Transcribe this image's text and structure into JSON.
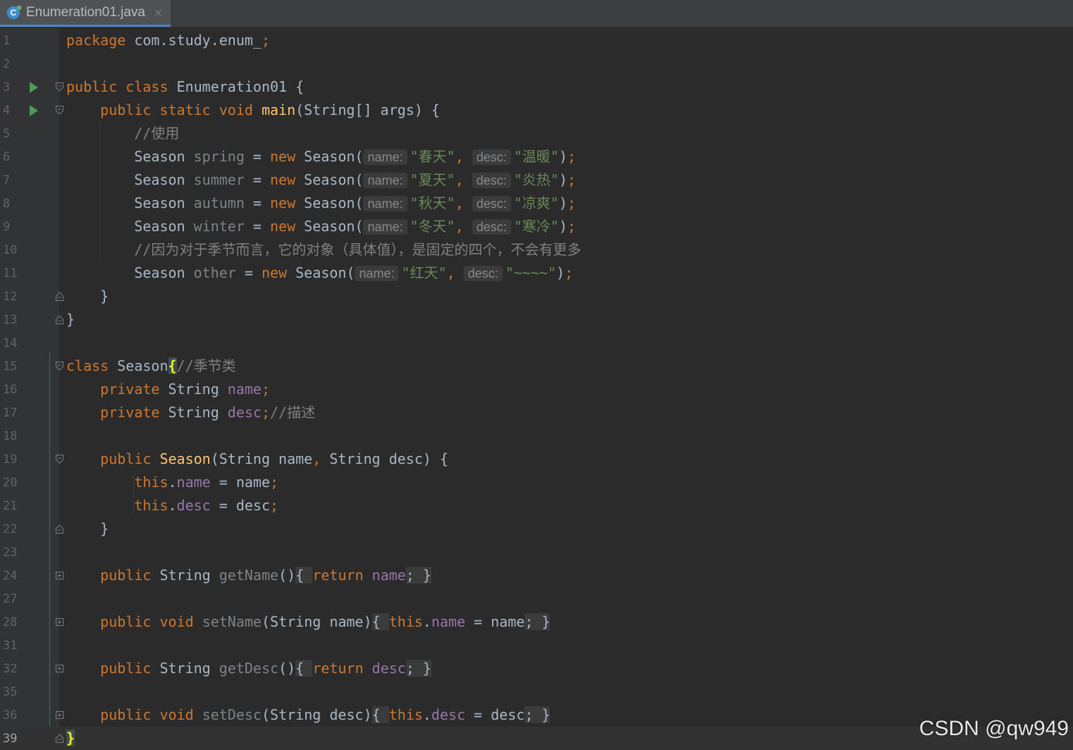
{
  "tab": {
    "title": "Enumeration01.java",
    "icon_letter": "C",
    "close_glyph": "×"
  },
  "editor": {
    "lines": [
      {
        "n": "1"
      },
      {
        "n": "2"
      },
      {
        "n": "3"
      },
      {
        "n": "4"
      },
      {
        "n": "5"
      },
      {
        "n": "6"
      },
      {
        "n": "7"
      },
      {
        "n": "8"
      },
      {
        "n": "9"
      },
      {
        "n": "10"
      },
      {
        "n": "11"
      },
      {
        "n": "12"
      },
      {
        "n": "13"
      },
      {
        "n": "14"
      },
      {
        "n": "15"
      },
      {
        "n": "16"
      },
      {
        "n": "17"
      },
      {
        "n": "18"
      },
      {
        "n": "19"
      },
      {
        "n": "20"
      },
      {
        "n": "21"
      },
      {
        "n": "22"
      },
      {
        "n": "23"
      },
      {
        "n": "24"
      },
      {
        "n": "27"
      },
      {
        "n": "28"
      },
      {
        "n": "31"
      },
      {
        "n": "32"
      },
      {
        "n": "35"
      },
      {
        "n": "36"
      },
      {
        "n": "39"
      }
    ],
    "code": {
      "l1_kw": "package",
      "l1_rest": " com.study.enum_",
      "l1_semi": ";",
      "l3_kw": "public class",
      "l3_rest": " Enumeration01 {",
      "l4_kw": "public static void",
      "l4_fn": "main",
      "l4_rest": "(String[] args) {",
      "l5_cm": "//使用",
      "type_season": "Season",
      "kw_new": "new",
      "ctor_call": "Season(",
      "hint_name": "name:",
      "hint_desc": "desc:",
      "comma": ",",
      "close_paren": ")",
      "semi": ";",
      "eq": " = ",
      "v_spring": "spring",
      "s_spring": "\"春天\"",
      "d_spring": "\"温暖\"",
      "v_summer": "summer",
      "s_summer": "\"夏天\"",
      "d_summer": "\"炎热\"",
      "v_autumn": "autumn",
      "s_autumn": "\"秋天\"",
      "d_autumn": "\"凉爽\"",
      "v_winter": "winter",
      "s_winter": "\"冬天\"",
      "d_winter": "\"寒冷\"",
      "l10_cm": "//因为对于季节而言，它的对象（具体值），是固定的四个，不会有更多",
      "v_other": "other",
      "s_other": "\"红天\"",
      "d_other": "\"~~~~\"",
      "close_brace": "}",
      "l15_kw": "class",
      "l15_name": " Season",
      "l15_brace": "{",
      "l15_cm": "//季节类",
      "kw_private": "private",
      "type_string": " String ",
      "f_name": "name",
      "f_desc": "desc",
      "l17_cm": "//描述",
      "kw_public": "public",
      "ctor_name": "Season",
      "ctor_params_a": "(String name",
      "ctor_params_b": " String desc) {",
      "kw_this": "this",
      "dot": ".",
      "assign_name": " = name",
      "assign_desc": " = desc",
      "kw_return": "return",
      "m_getName": "getName",
      "m_setName": "setName",
      "m_getDesc": "getDesc",
      "m_setDesc": "setDesc",
      "kw_void": "void",
      "empty_parens": "()",
      "param_name": "(String name)",
      "param_desc": "(String desc)",
      "open_fold": "{ ",
      "close_fold": " }"
    }
  },
  "watermark": "CSDN @qw949",
  "colors": {
    "background": "#2b2b2b",
    "keyword": "#cc7832",
    "string": "#6a8759",
    "comment": "#808080",
    "field": "#9876aa",
    "method_decl": "#ffc66d",
    "run_icon": "#499c54"
  }
}
